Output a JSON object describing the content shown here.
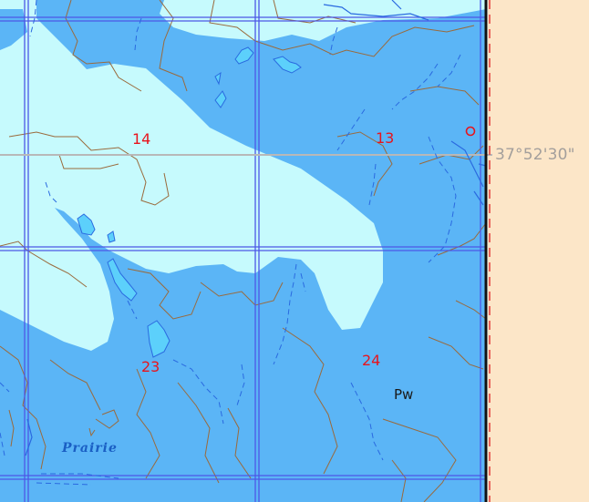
{
  "map": {
    "colors": {
      "shallow_water": "#c6fafd",
      "deep_water": "#5bb5f6",
      "land_strip": "#fce6c8",
      "grid_line": "#4d57e6",
      "contour": "#9a6a3c",
      "stream": "#2a6ae0",
      "latitude_line": "#b8b8b8",
      "section_number": "#e8141c",
      "pond": "#5cd0fb"
    },
    "sections": [
      {
        "number": "14"
      },
      {
        "number": "13"
      },
      {
        "number": "23"
      },
      {
        "number": "24"
      }
    ],
    "coordinate_label": "37°52'30\"",
    "place_labels": {
      "pw": "Pw",
      "prairie": "Prairie"
    },
    "icons": {
      "well_marker": "circle-icon"
    }
  }
}
